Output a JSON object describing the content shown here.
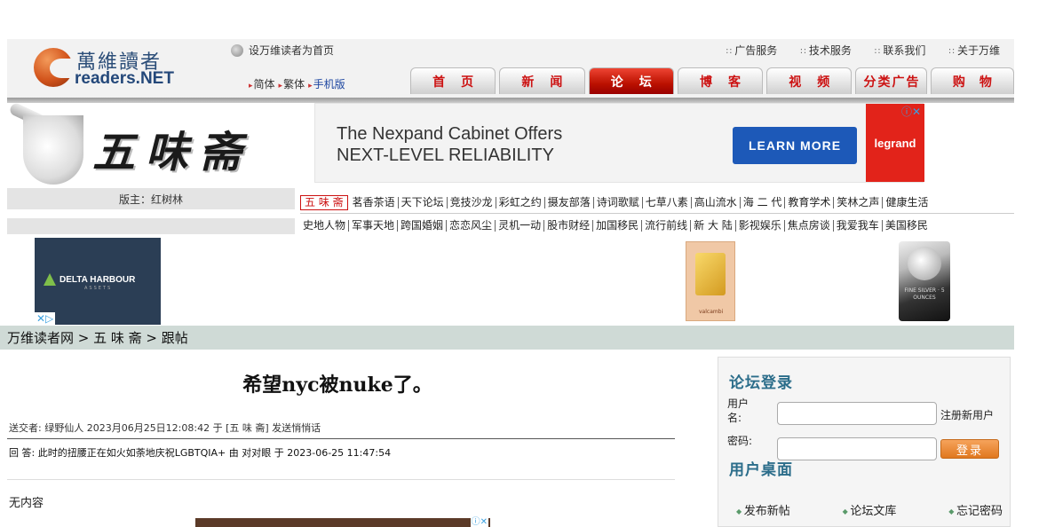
{
  "header": {
    "logo_cn": "萬維讀者",
    "logo_en": "readers.NET",
    "set_home": "设万维读者为首页",
    "top_links": [
      "广告服务",
      "技术服务",
      "联系我们",
      "关于万维"
    ],
    "lang": {
      "simplified": "简体",
      "traditional": "繁体",
      "mobile": "手机版"
    },
    "nav": [
      "首页",
      "新闻",
      "论坛",
      "博客",
      "视频",
      "分类广告",
      "购物"
    ],
    "nav_active": "论坛"
  },
  "forum": {
    "title": "五味斋",
    "moderator": "版主：红树林"
  },
  "ad_banner": {
    "text_line1": "The Nexpand Cabinet Offers",
    "text_line2": "NEXT-LEVEL RELIABILITY",
    "button": "LEARN MORE",
    "brand": "legrand",
    "ad_choices": "ⓘ✕"
  },
  "boards_row1": [
    "五 味 斋",
    "茗香茶语",
    "天下论坛",
    "竞技沙龙",
    "彩虹之约",
    "摄友部落",
    "诗词歌赋",
    "七草八素",
    "高山流水",
    "海 二 代",
    "教育学术",
    "笑林之声",
    "健康生活"
  ],
  "boards_row2": [
    "史地人物",
    "军事天地",
    "跨国婚姻",
    "恋恋风尘",
    "灵机一动",
    "股市财经",
    "加国移民",
    "流行前线",
    "新 大 陆",
    "影视娱乐",
    "焦点房谈",
    "我爱我车",
    "美国移民"
  ],
  "ad_row2": {
    "left_brand": "DELTA HARBOUR",
    "left_sub": "ASSETS",
    "left_choices": "✕▷",
    "gold_label": "valcambi",
    "silver_text": "FINE SILVER · 5 OUNCES"
  },
  "breadcrumb": "万维读者网 > 五 味 斋 > 跟帖",
  "post": {
    "title": "希望nyc被nuke了。",
    "meta": "送交者: 绿野仙人 2023月06月25日12:08:42 于 [五 味 斋] 发送悄悄话",
    "reply": "回  答: 此时的扭腰正在如火如荼地庆祝LGBTQIA+ 由 对对眼 于 2023-06-25 11:47:54",
    "body": "无内容",
    "ad_choices": "ⓘ✕"
  },
  "login": {
    "title": "论坛登录",
    "username_label": "用户名:",
    "password_label": "密码:",
    "register": "注册新用户",
    "login_button": "登录",
    "desk_title": "用户桌面",
    "desk_links": [
      "发布新帖",
      "论坛文库",
      "忘记密码"
    ]
  }
}
